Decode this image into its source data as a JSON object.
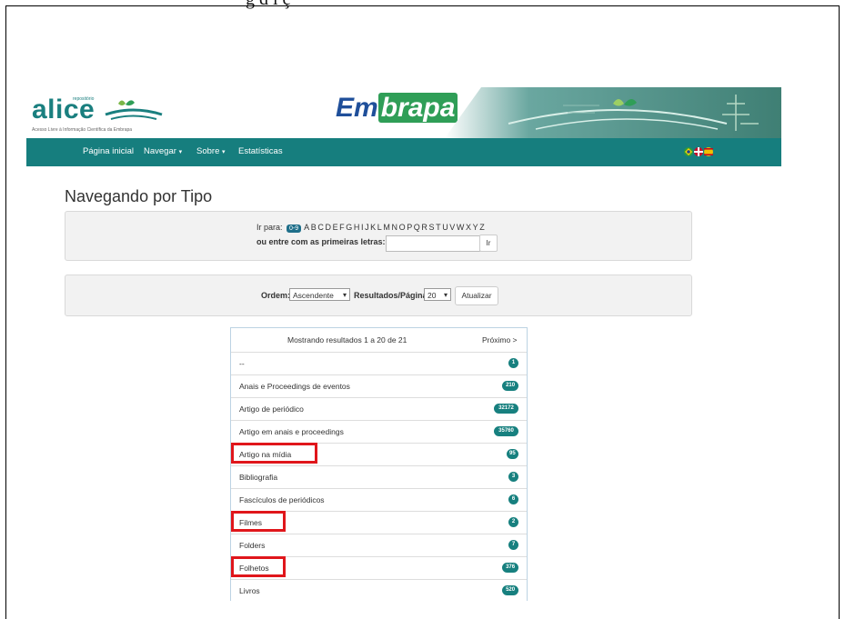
{
  "figure": {
    "caption_fragment": "g     d  i  ç  "
  },
  "banner": {
    "alice_word": "alice",
    "alice_repo_label": "repositório",
    "alice_tagline": "Acesso Livre à Informação Científica da Embrapa",
    "embrapa_logo": "Embrapa"
  },
  "nav": {
    "items": [
      {
        "label": "Página inicial",
        "has_menu": false
      },
      {
        "label": "Navegar",
        "has_menu": true
      },
      {
        "label": "Sobre",
        "has_menu": true
      },
      {
        "label": "Estatísticas",
        "has_menu": false
      }
    ],
    "caret": "▾",
    "language_icons": [
      "brazil-flag-icon",
      "uk-flag-icon",
      "spain-flag-icon"
    ]
  },
  "page": {
    "title": "Navegando por Tipo"
  },
  "jump": {
    "goto_label": "Ir para:",
    "numeric_badge": "0-9",
    "letters": [
      "A",
      "B",
      "C",
      "D",
      "E",
      "F",
      "G",
      "H",
      "I",
      "J",
      "K",
      "L",
      "M",
      "N",
      "O",
      "P",
      "Q",
      "R",
      "S",
      "T",
      "U",
      "V",
      "W",
      "X",
      "Y",
      "Z"
    ],
    "first_letters_label": "ou entre com as primeiras letras:",
    "first_letters_value": "",
    "go_button": "Ir"
  },
  "sort": {
    "order_label": "Ordem:",
    "order_value": "Ascendente",
    "per_page_label": "Resultados/Página",
    "per_page_value": "20",
    "update_button": "Atualizar"
  },
  "results": {
    "summary": "Mostrando resultados 1 a 20 de 21",
    "next": "Próximo >",
    "rows": [
      {
        "label": "--",
        "count": "1",
        "highlighted": false
      },
      {
        "label": "Anais e Proceedings de eventos",
        "count": "210",
        "highlighted": false
      },
      {
        "label": "Artigo de periódico",
        "count": "32172",
        "highlighted": false
      },
      {
        "label": "Artigo em anais e proceedings",
        "count": "35760",
        "highlighted": false
      },
      {
        "label": "Artigo na mídia",
        "count": "95",
        "highlighted": true
      },
      {
        "label": "Bibliografia",
        "count": "3",
        "highlighted": false
      },
      {
        "label": "Fascículos de periódicos",
        "count": "6",
        "highlighted": false
      },
      {
        "label": "Filmes",
        "count": "2",
        "highlighted": true
      },
      {
        "label": "Folders",
        "count": "7",
        "highlighted": false
      },
      {
        "label": "Folhetos",
        "count": "376",
        "highlighted": true
      },
      {
        "label": "Livros",
        "count": "520",
        "highlighted": false
      }
    ]
  },
  "colors": {
    "navbar": "#167e7e",
    "badge": "#17807f",
    "highlight": "#e0161b",
    "embrapa_blue": "#1f4f9a"
  }
}
